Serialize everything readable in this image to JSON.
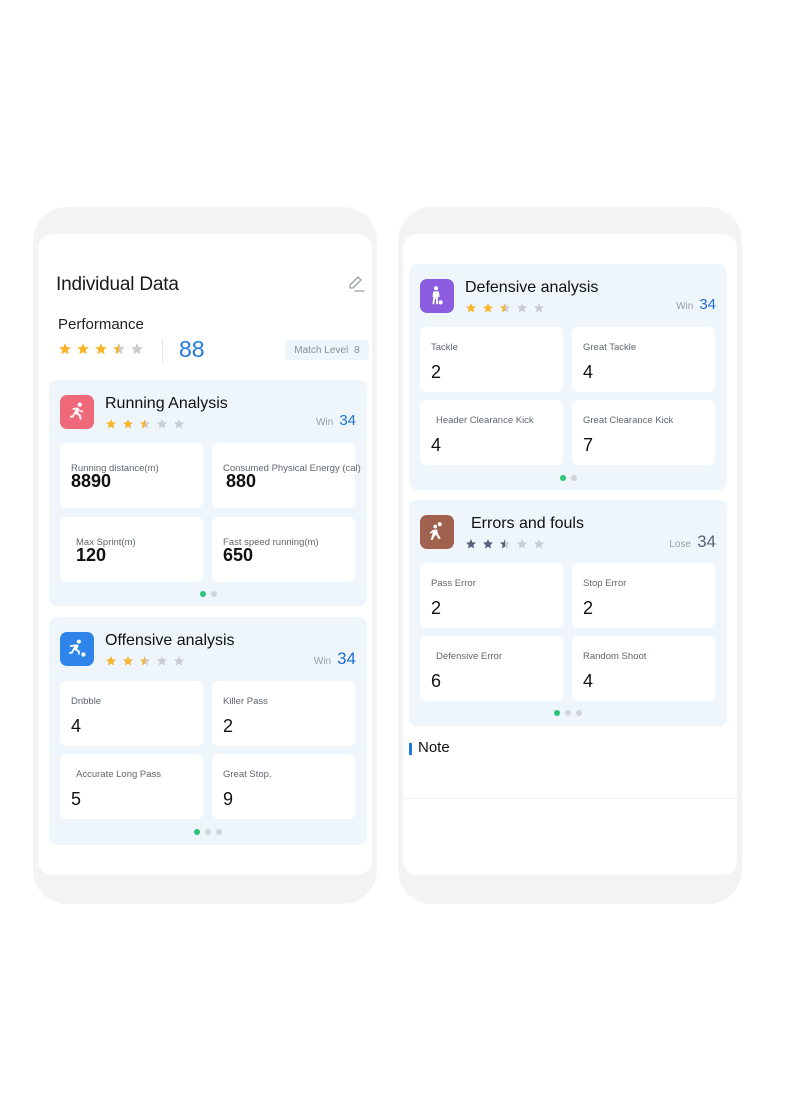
{
  "colors": {
    "accent_blue": "#1f7ae0",
    "dot_active": "#2bc47a",
    "star_gold": "#f7b52c",
    "star_grey": "#c9ccd2",
    "star_navy": "#5b5f7a",
    "running_icon_bg": "#f0697a",
    "offensive_icon_bg": "#2f84ea",
    "defensive_icon_bg": "#8b5ce0",
    "errors_icon_bg": "#a0614f"
  },
  "left_screen": {
    "header": {
      "title": "Individual Data",
      "edit_icon": "edit-pencil-icon",
      "performance_label": "Performance",
      "performance_rating": 3.5,
      "performance_score": "88",
      "match_level_label": "Match Level",
      "match_level_value": "8"
    },
    "cards": [
      {
        "title": "Running Analysis",
        "icon": "running-person-icon",
        "rating": 2.5,
        "result_label": "Win",
        "result_value": "34",
        "tiles": [
          {
            "label": "Running distance(m)",
            "value": "8890"
          },
          {
            "label": "Consumed Physical Energy (cal)",
            "value": "880"
          },
          {
            "label": "Max Sprint(m)",
            "value": "120"
          },
          {
            "label": "Fast speed running(m)",
            "value": "650"
          }
        ],
        "pages": 2,
        "active_page": 1
      },
      {
        "title": "Offensive analysis",
        "icon": "player-dribbling-icon",
        "rating": 2.5,
        "result_label": "Win",
        "result_value": "34",
        "tiles": [
          {
            "label": "Dribble",
            "value": "4"
          },
          {
            "label": "Killer Pass",
            "value": "2"
          },
          {
            "label": "Accurate Long Pass",
            "value": "5"
          },
          {
            "label": "Great Stop.",
            "value": "9"
          }
        ],
        "pages": 3,
        "active_page": 1
      }
    ]
  },
  "right_screen": {
    "cards": [
      {
        "title": "Defensive analysis",
        "icon": "player-standing-ball-icon",
        "rating": 2.5,
        "result_label": "Win",
        "result_value": "34",
        "tiles": [
          {
            "label": "Tackle",
            "value": "2"
          },
          {
            "label": "Great Tackle",
            "value": "4"
          },
          {
            "label": "Header Clearance Kick",
            "value": "4"
          },
          {
            "label": "Great Clearance Kick",
            "value": "7"
          }
        ],
        "pages": 2,
        "active_page": 1
      },
      {
        "title": "Errors and fouls",
        "icon": "player-header-icon",
        "rating": 2.5,
        "result_label": "Lose",
        "result_value": "34",
        "tiles": [
          {
            "label": "Pass Error",
            "value": "2"
          },
          {
            "label": "Stop Error",
            "value": "2"
          },
          {
            "label": "Defensive Error",
            "value": "6"
          },
          {
            "label": "Random Shoot",
            "value": "4"
          }
        ],
        "pages": 3,
        "active_page": 1
      }
    ],
    "note_label": "Note"
  }
}
